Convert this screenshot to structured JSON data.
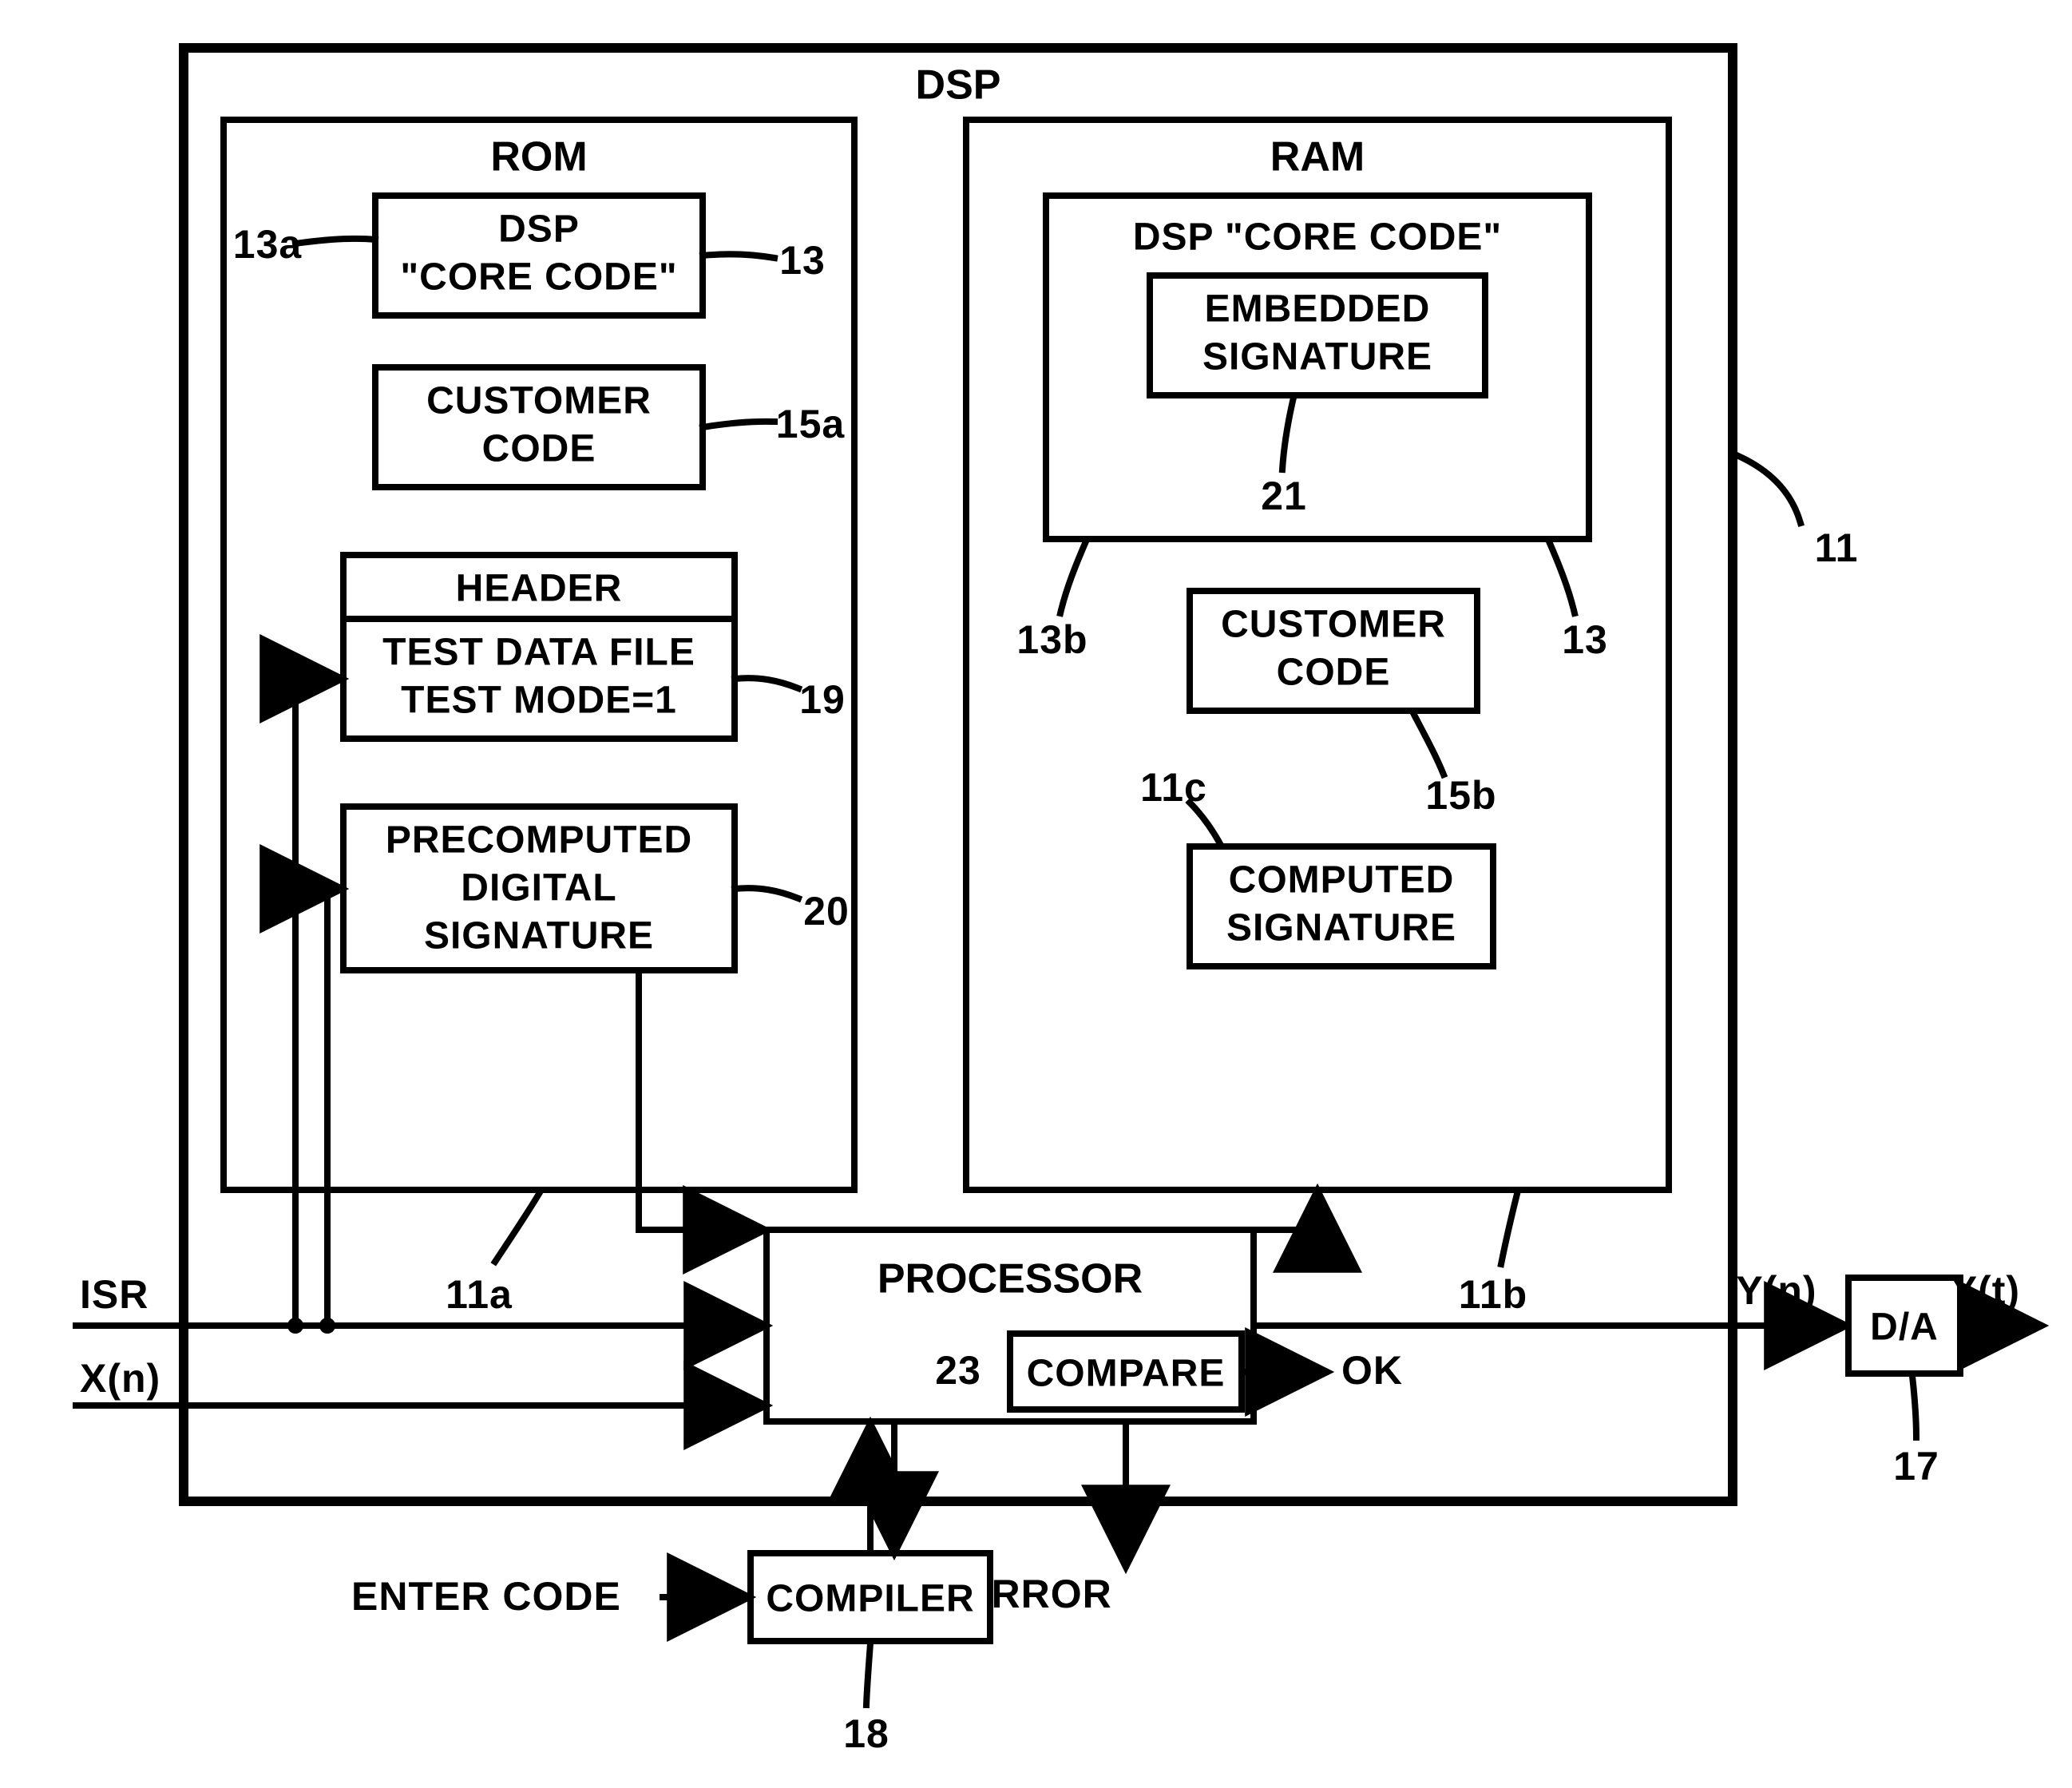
{
  "dsp": {
    "title": "DSP"
  },
  "rom": {
    "title": "ROM",
    "core": "DSP\n\"CORE CODE\"",
    "cust": "CUSTOMER\nCODE",
    "hdr": "HEADER",
    "tdf1": "TEST DATA FILE",
    "tdf2": "TEST MODE=1",
    "precomp": "PRECOMPUTED\nDIGITAL\nSIGNATURE"
  },
  "ram": {
    "title": "RAM",
    "core": "DSP \"CORE CODE\"",
    "emb": "EMBEDDED\nSIGNATURE",
    "cust": "CUSTOMER\nCODE",
    "comp": "COMPUTED\nSIGNATURE"
  },
  "proc": {
    "title": "PROCESSOR",
    "cmp": "COMPARE"
  },
  "ext": {
    "da": "D/A",
    "compiler": "COMPILER",
    "enter": "ENTER CODE"
  },
  "io": {
    "isr": "ISR",
    "xn": "X(n)",
    "ok": "OK",
    "err": "ERROR",
    "yn": "Y(n)",
    "yt": "Y(t)"
  },
  "ref": {
    "r11": "11",
    "r11a": "11a",
    "r11b": "11b",
    "r11c": "11c",
    "r13": "13",
    "r13a": "13a",
    "r13b": "13b",
    "r15a": "15a",
    "r15b": "15b",
    "r17": "17",
    "r18": "18",
    "r19": "19",
    "r20": "20",
    "r21": "21",
    "r23": "23"
  }
}
